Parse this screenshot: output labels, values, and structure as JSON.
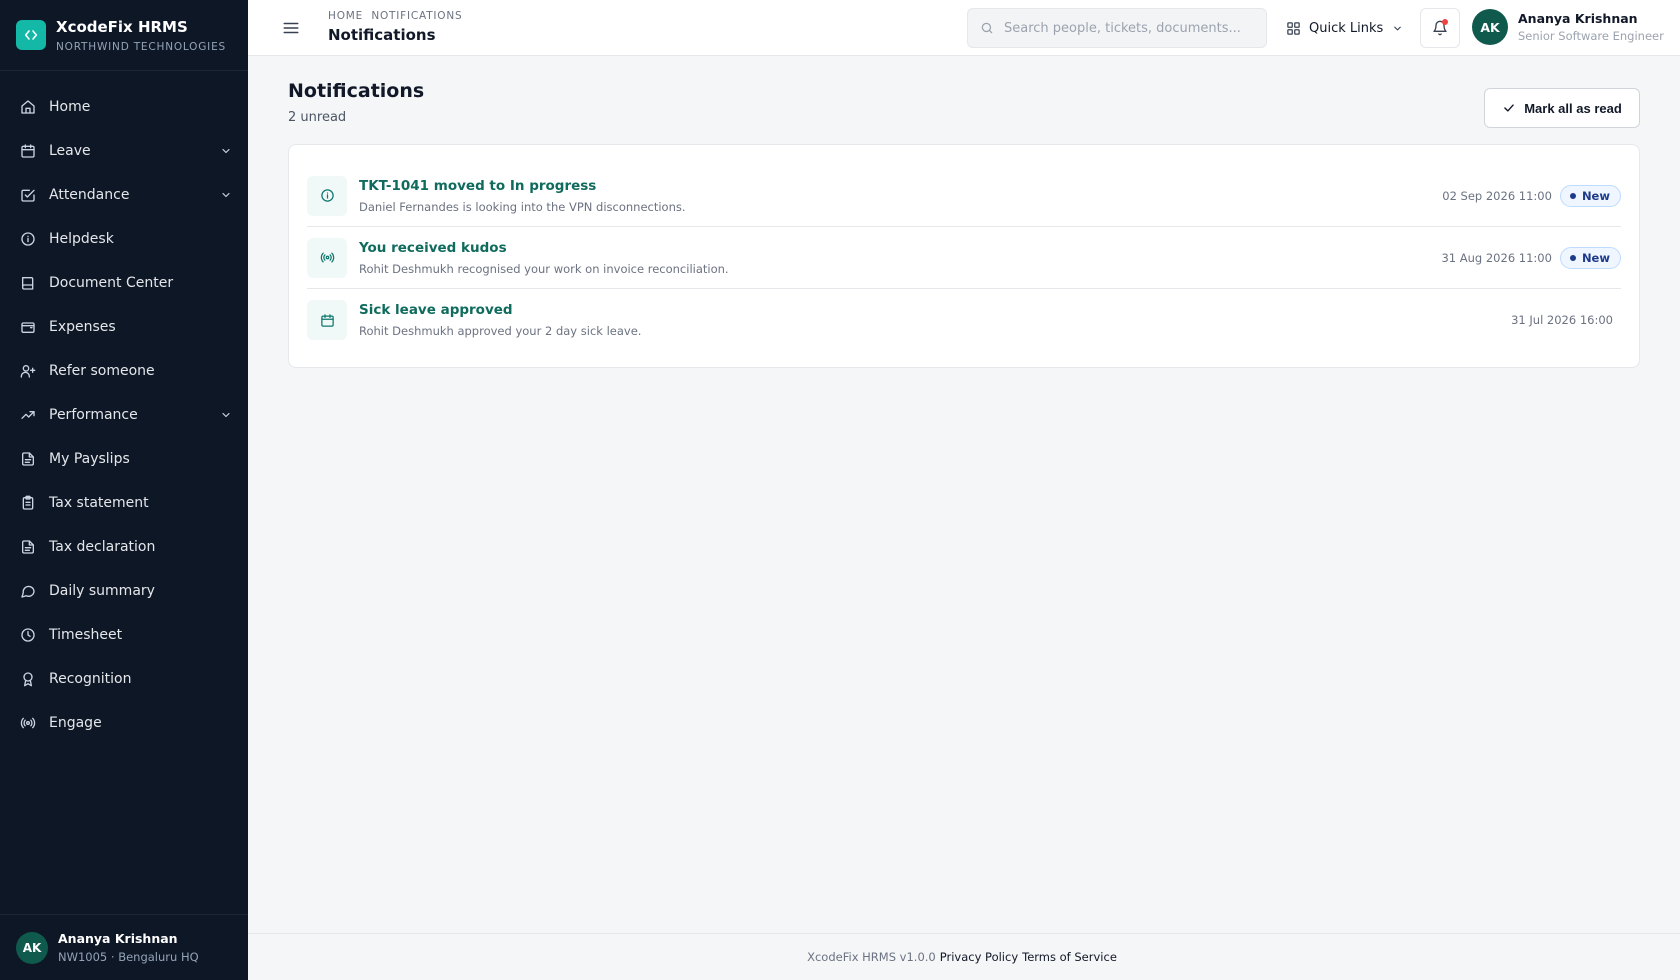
{
  "brand": {
    "name": "XcodeFix HRMS",
    "org": "NORTHWIND TECHNOLOGIES",
    "logo_icon": "code-icon",
    "accent": "#14b8a6"
  },
  "sidebar": {
    "items": [
      {
        "label": "Home",
        "icon": "home-icon",
        "expandable": false
      },
      {
        "label": "Leave",
        "icon": "calendar-icon",
        "expandable": true
      },
      {
        "label": "Attendance",
        "icon": "calendar-check-icon",
        "expandable": true
      },
      {
        "label": "Helpdesk",
        "icon": "info-icon",
        "expandable": false
      },
      {
        "label": "Document Center",
        "icon": "book-icon",
        "expandable": false
      },
      {
        "label": "Expenses",
        "icon": "wallet-icon",
        "expandable": false
      },
      {
        "label": "Refer someone",
        "icon": "user-plus-icon",
        "expandable": false
      },
      {
        "label": "Performance",
        "icon": "trending-up-icon",
        "expandable": true
      },
      {
        "label": "My Payslips",
        "icon": "file-text-icon",
        "expandable": false
      },
      {
        "label": "Tax statement",
        "icon": "clipboard-icon",
        "expandable": false
      },
      {
        "label": "Tax declaration",
        "icon": "file-text-icon",
        "expandable": false
      },
      {
        "label": "Daily summary",
        "icon": "message-circle-icon",
        "expandable": false
      },
      {
        "label": "Timesheet",
        "icon": "clock-icon",
        "expandable": false
      },
      {
        "label": "Recognition",
        "icon": "award-icon",
        "expandable": false
      },
      {
        "label": "Engage",
        "icon": "radio-icon",
        "expandable": false
      }
    ],
    "user": {
      "initials": "AK",
      "name": "Ananya Krishnan",
      "meta": "NW1005 · Bengaluru HQ"
    }
  },
  "header": {
    "breadcrumb": "HOME  NOTIFICATIONS",
    "title": "Notifications",
    "search_placeholder": "Search people, tickets, documents...",
    "search_value": "",
    "quick_links_label": "Quick Links",
    "user": {
      "initials": "AK",
      "name": "Ananya Krishnan",
      "role": "Senior Software Engineer"
    }
  },
  "main": {
    "title": "Notifications",
    "unread_text": "2 unread",
    "mark_all_label": "Mark all as read",
    "notifications": [
      {
        "title": "TKT-1041 moved to In progress",
        "description": "Daniel Fernandes is looking into the VPN disconnections.",
        "time": "02 Sep 2026 11:00",
        "badge": "New",
        "icon": "info-icon"
      },
      {
        "title": "You received kudos",
        "description": "Rohit Deshmukh recognised your work on invoice reconciliation.",
        "time": "31 Aug 2026 11:00",
        "badge": "New",
        "icon": "radio-icon"
      },
      {
        "title": "Sick leave approved",
        "description": "Rohit Deshmukh approved your 2 day sick leave.",
        "time": "31 Jul 2026 16:00",
        "badge": "",
        "icon": "calendar-icon"
      }
    ]
  },
  "footer": {
    "version": "XcodeFix HRMS v1.0.0",
    "privacy": "Privacy Policy",
    "terms": "Terms of Service"
  }
}
